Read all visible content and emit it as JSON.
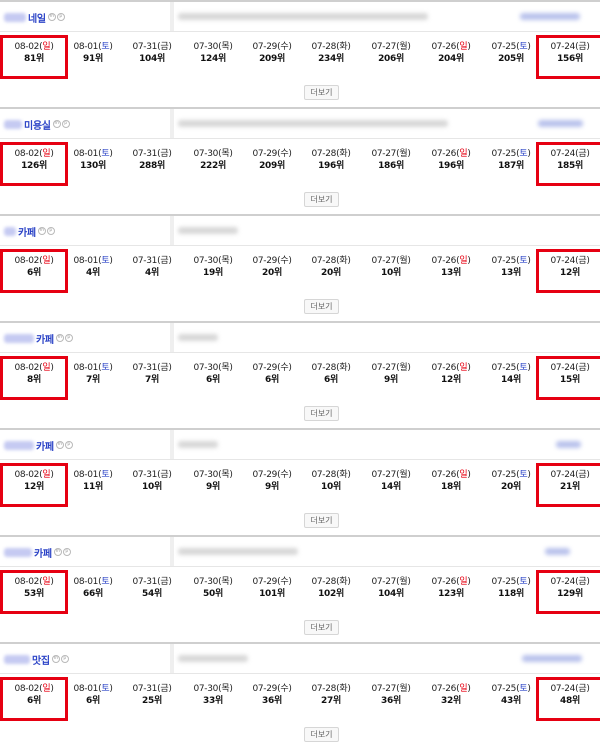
{
  "dates": [
    {
      "md": "08-02",
      "dow": "일",
      "type": "sun"
    },
    {
      "md": "08-01",
      "dow": "토",
      "type": "sat"
    },
    {
      "md": "07-31",
      "dow": "금",
      "type": "wk"
    },
    {
      "md": "07-30",
      "dow": "목",
      "type": "wk"
    },
    {
      "md": "07-29",
      "dow": "수",
      "type": "wk"
    },
    {
      "md": "07-28",
      "dow": "화",
      "type": "wk"
    },
    {
      "md": "07-27",
      "dow": "월",
      "type": "wk"
    },
    {
      "md": "07-26",
      "dow": "일",
      "type": "sun"
    },
    {
      "md": "07-25",
      "dow": "토",
      "type": "sat"
    },
    {
      "md": "07-24",
      "dow": "금",
      "type": "wk"
    }
  ],
  "badges": [
    "m",
    "p"
  ],
  "more_label": "더보기",
  "highlight_color": "#e60012",
  "name_color": "#2d45c7",
  "sunday_color": "#e60012",
  "saturday_color": "#2d45c7",
  "cards": [
    {
      "name": "네일",
      "ranks": [
        "81위",
        "91위",
        "104위",
        "124위",
        "209위",
        "234위",
        "206위",
        "204위",
        "205위",
        "156위"
      ]
    },
    {
      "name": "미용실",
      "ranks": [
        "126위",
        "130위",
        "288위",
        "222위",
        "209위",
        "196위",
        "186위",
        "196위",
        "187위",
        "185위"
      ]
    },
    {
      "name": "카페",
      "ranks": [
        "6위",
        "4위",
        "4위",
        "19위",
        "20위",
        "20위",
        "10위",
        "13위",
        "13위",
        "12위"
      ]
    },
    {
      "name": "카페",
      "ranks": [
        "8위",
        "7위",
        "7위",
        "6위",
        "6위",
        "6위",
        "9위",
        "12위",
        "14위",
        "15위"
      ]
    },
    {
      "name": "카페",
      "ranks": [
        "12위",
        "11위",
        "10위",
        "9위",
        "9위",
        "10위",
        "14위",
        "18위",
        "20위",
        "21위"
      ]
    },
    {
      "name": "카페",
      "ranks": [
        "53위",
        "66위",
        "54위",
        "50위",
        "101위",
        "102위",
        "104위",
        "123위",
        "118위",
        "129위"
      ]
    },
    {
      "name": "맛집",
      "ranks": [
        "6위",
        "6위",
        "25위",
        "33위",
        "36위",
        "27위",
        "36위",
        "32위",
        "43위",
        "48위"
      ]
    }
  ]
}
